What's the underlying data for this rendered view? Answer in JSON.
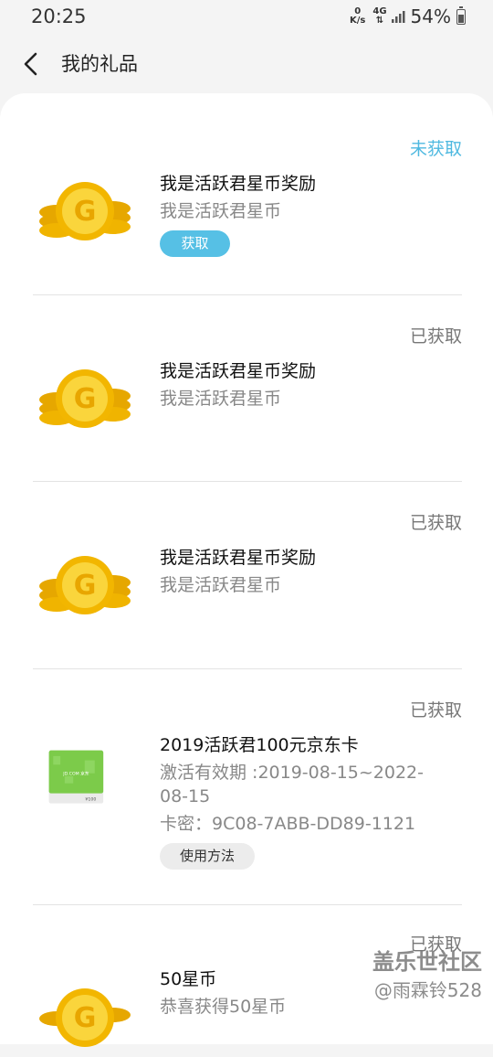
{
  "status_bar": {
    "time": "20:25",
    "net_speed_value": "0",
    "net_speed_unit": "K/s",
    "network_type": "4G",
    "battery": "54%"
  },
  "header": {
    "title": "我的礼品"
  },
  "items": [
    {
      "status": "未获取",
      "title": "我是活跃君星币奖励",
      "subtitle": "我是活跃君星币",
      "button": "获取",
      "icon": "gold-coin-icon"
    },
    {
      "status": "已获取",
      "title": "我是活跃君星币奖励",
      "subtitle": "我是活跃君星币",
      "icon": "gold-coin-icon"
    },
    {
      "status": "已获取",
      "title": "我是活跃君星币奖励",
      "subtitle": "我是活跃君星币",
      "icon": "gold-coin-icon"
    },
    {
      "status": "已获取",
      "title": "2019活跃君100元京东卡",
      "validity_line1": "激活有效期 :2019-08-15~2022-",
      "validity_line2": "08-15",
      "card_code": "卡密：9C08-7ABB-DD89-1121",
      "button": "使用方法",
      "icon": "jd-gift-card-icon",
      "card_label": "JD.COM 京东",
      "card_value": "¥100"
    },
    {
      "status": "已获取",
      "title": "50星币",
      "subtitle": "恭喜获得50星币",
      "icon": "gold-coin-icon"
    }
  ],
  "watermark": {
    "line1": "盖乐世社区",
    "line2": "@雨霖铃528"
  },
  "colors": {
    "accent": "#56c0e5",
    "status_active": "#4fb9e0",
    "coin": "#f5c518"
  }
}
